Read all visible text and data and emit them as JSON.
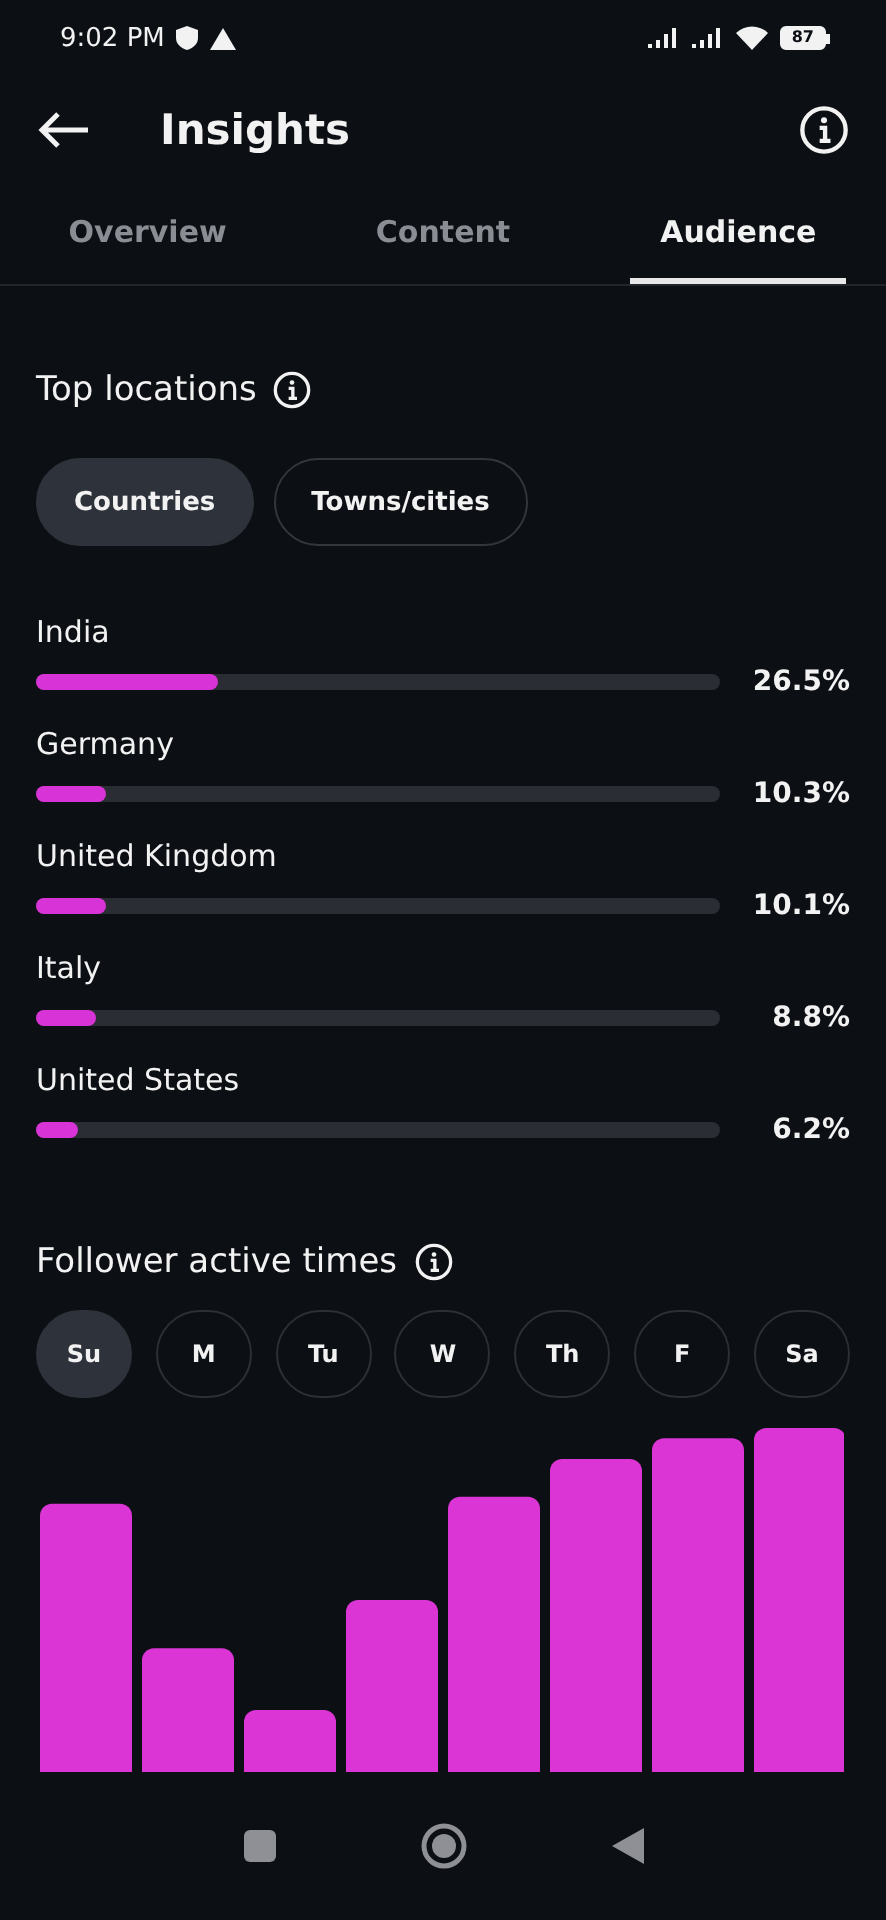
{
  "status_bar": {
    "time": "9:02 PM",
    "battery": "87"
  },
  "header": {
    "title": "Insights"
  },
  "tabs": [
    {
      "label": "Overview",
      "selected": false
    },
    {
      "label": "Content",
      "selected": false
    },
    {
      "label": "Audience",
      "selected": true
    }
  ],
  "top_locations": {
    "title": "Top locations",
    "filters": [
      {
        "label": "Countries",
        "selected": true
      },
      {
        "label": "Towns/cities",
        "selected": false
      }
    ],
    "rows": [
      {
        "name": "India",
        "level": 0.265,
        "reading": "26.5%"
      },
      {
        "name": "Germany",
        "level": 0.103,
        "reading": "10.3%"
      },
      {
        "name": "United Kingdom",
        "level": 0.101,
        "reading": "10.1%"
      },
      {
        "name": "Italy",
        "level": 0.088,
        "reading": "8.8%"
      },
      {
        "name": "United States",
        "level": 0.062,
        "reading": "6.2%"
      }
    ]
  },
  "active_times": {
    "title": "Follower active times",
    "days": [
      {
        "label": "Su",
        "selected": true
      },
      {
        "label": "M",
        "selected": false
      },
      {
        "label": "Tu",
        "selected": false
      },
      {
        "label": "W",
        "selected": false
      },
      {
        "label": "Th",
        "selected": false
      },
      {
        "label": "F",
        "selected": false
      },
      {
        "label": "Sa",
        "selected": false
      }
    ]
  }
}
